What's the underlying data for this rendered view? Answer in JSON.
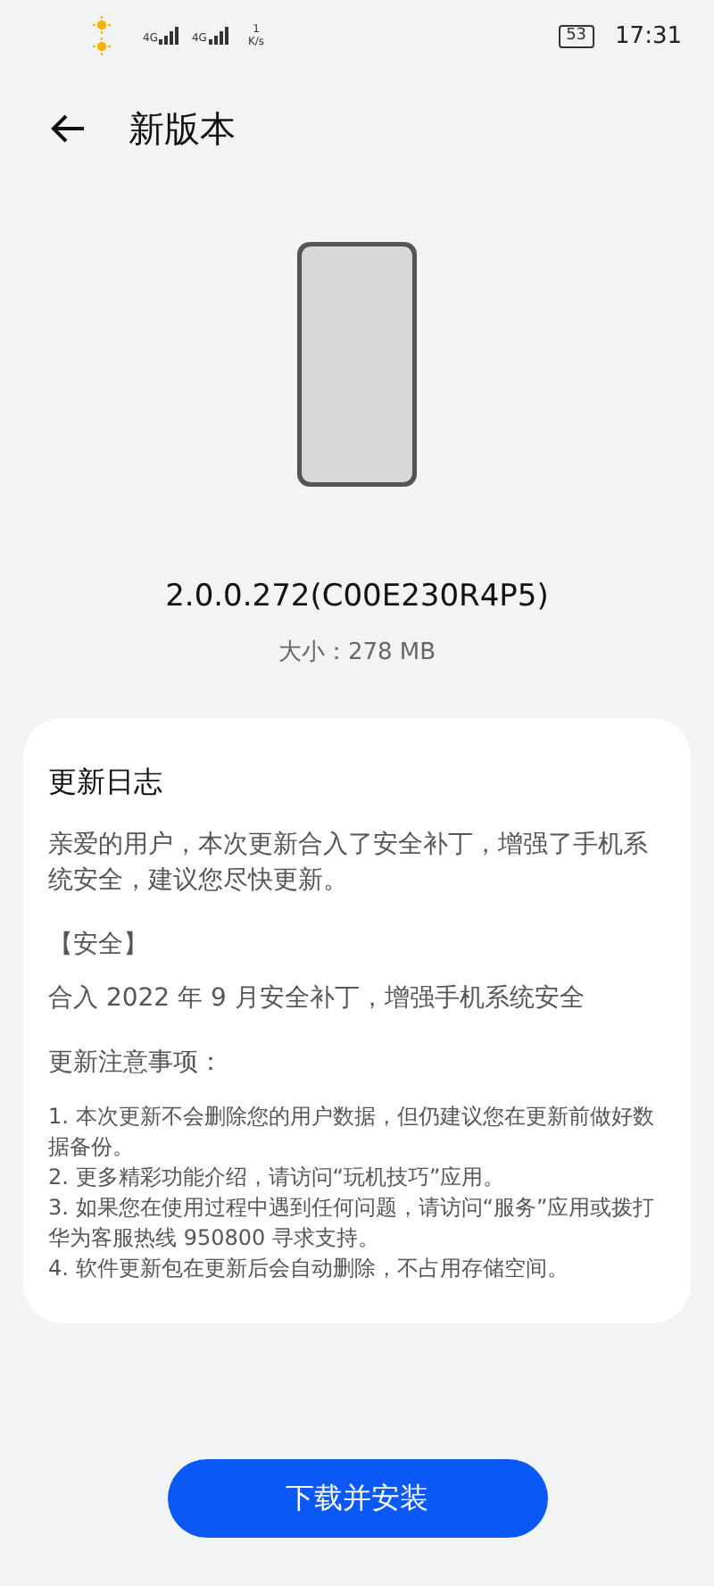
{
  "status_bar": {
    "sim_labels": [
      "4G",
      "4G"
    ],
    "speed_value": "1",
    "speed_unit": "K/s",
    "battery": "53",
    "time": "17:31"
  },
  "header": {
    "title": "新版本"
  },
  "version": "2.0.0.272(C00E230R4P5)",
  "size": "大小：278 MB",
  "changelog": {
    "title": "更新日志",
    "intro": "亲爱的用户，本次更新合入了安全补丁，增强了手机系统安全，建议您尽快更新。",
    "section": "【安全】",
    "section_text": "合入 2022 年 9 月安全补丁，增强手机系统安全",
    "notes_title": "更新注意事项：",
    "notes": [
      "1. 本次更新不会删除您的用户数据，但仍建议您在更新前做好数据备份。",
      "2. 更多精彩功能介绍，请访问“玩机技巧”应用。",
      "3. 如果您在使用过程中遇到任何问题，请访问“服务”应用或拨打华为客服热线 950800 寻求支持。",
      "4. 软件更新包在更新后会自动删除，不占用存储空间。"
    ]
  },
  "button": "下载并安装"
}
